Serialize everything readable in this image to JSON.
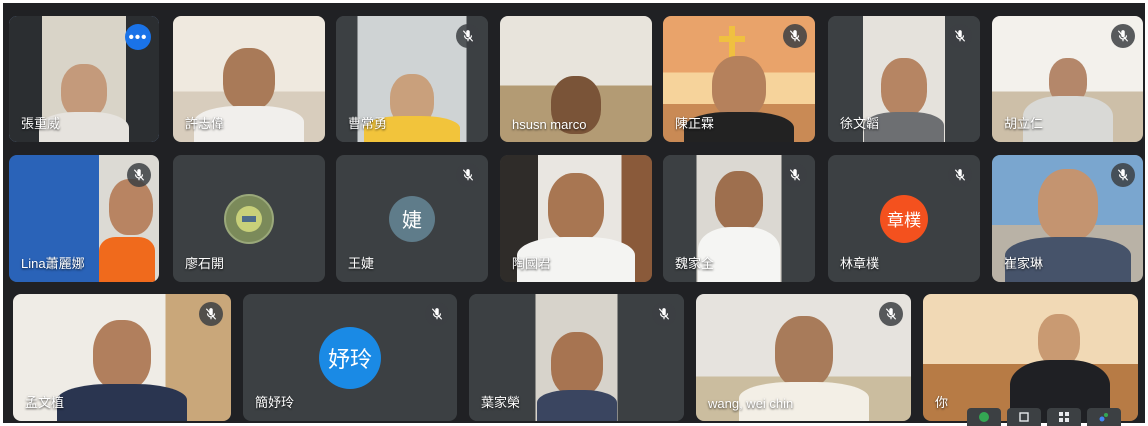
{
  "participants": [
    {
      "name": "張重威",
      "options_label": "•••"
    },
    {
      "name": "許志偉"
    },
    {
      "name": "曹常勇"
    },
    {
      "name": "hsusn marco"
    },
    {
      "name": "陳正霖"
    },
    {
      "name": "徐文韜"
    },
    {
      "name": "胡立仁"
    },
    {
      "name": "Lina蕭麗娜"
    },
    {
      "name": "廖石開"
    },
    {
      "name": "王婕",
      "avatar_text": "婕"
    },
    {
      "name": "陶國君"
    },
    {
      "name": "魏家全"
    },
    {
      "name": "林章樸",
      "avatar_text": "章樸"
    },
    {
      "name": "崔家琳"
    },
    {
      "name": "孟文植"
    },
    {
      "name": "簡妤玲",
      "avatar_text": "妤玲"
    },
    {
      "name": "葉家榮"
    },
    {
      "name": "wang, wei chin"
    },
    {
      "name": "你"
    }
  ],
  "colors": {
    "stage": "#202124",
    "tile": "#3c4043",
    "active_outline": "#8ab4f8",
    "avatar_wang_jie": "#5f7c8a",
    "avatar_lin": "#f4511e",
    "avatar_jian": "#1a8ae5"
  },
  "icons": [
    "mic-off-icon",
    "more-options-icon",
    "chat-icon",
    "participants-icon",
    "grid-icon",
    "activities-icon"
  ]
}
